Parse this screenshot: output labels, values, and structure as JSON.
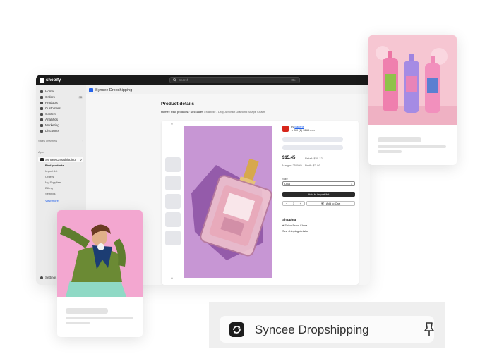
{
  "admin": {
    "brand": "shopify",
    "search_placeholder": "Search",
    "search_shortcut": "⌘ K",
    "nav": [
      {
        "label": "Home",
        "icon": "home-icon"
      },
      {
        "label": "Orders",
        "icon": "orders-icon",
        "badge": "10"
      },
      {
        "label": "Products",
        "icon": "tag-icon"
      },
      {
        "label": "Customers",
        "icon": "person-icon"
      },
      {
        "label": "Content",
        "icon": "content-icon"
      },
      {
        "label": "Analytics",
        "icon": "chart-icon"
      },
      {
        "label": "Marketing",
        "icon": "target-icon"
      },
      {
        "label": "Discounts",
        "icon": "discount-icon"
      }
    ],
    "sales_channels_label": "Sales channels",
    "apps_label": "Apps",
    "app_name": "Syncee Dropshipping",
    "app_subnav": [
      "Find products",
      "Import list",
      "Orders",
      "My Suppliers",
      "Billing",
      "Settings"
    ],
    "view_more": "View more",
    "settings_label": "Settings"
  },
  "content": {
    "app_title": "Syncee Dropshipping",
    "page_title": "Product details",
    "breadcrumb": [
      "Home",
      "Find products",
      "Necklaces",
      "Mabelle - Drop Abstract Diamond Shape Charm"
    ],
    "supplier": {
      "prefix": "by",
      "name": "Bakeris",
      "rating": "★ 5.0 (2)",
      "ships": "$166 min"
    },
    "price": "$15.45",
    "retail": "Retail: $30.12",
    "margin": "Margin: 25.00%",
    "profit": "Profit: $3.86",
    "size_label": "Size",
    "size_value": "Oval",
    "import_button": "Add to import list",
    "qty": {
      "minus": "−",
      "value": "1",
      "plus": "+"
    },
    "cart_button": "Add to Cart",
    "shipping_title": "Shipping",
    "ships_from": "Ships From China",
    "shipping_link": "See shipping details"
  },
  "pill": {
    "label": "Syncee Dropshipping"
  }
}
